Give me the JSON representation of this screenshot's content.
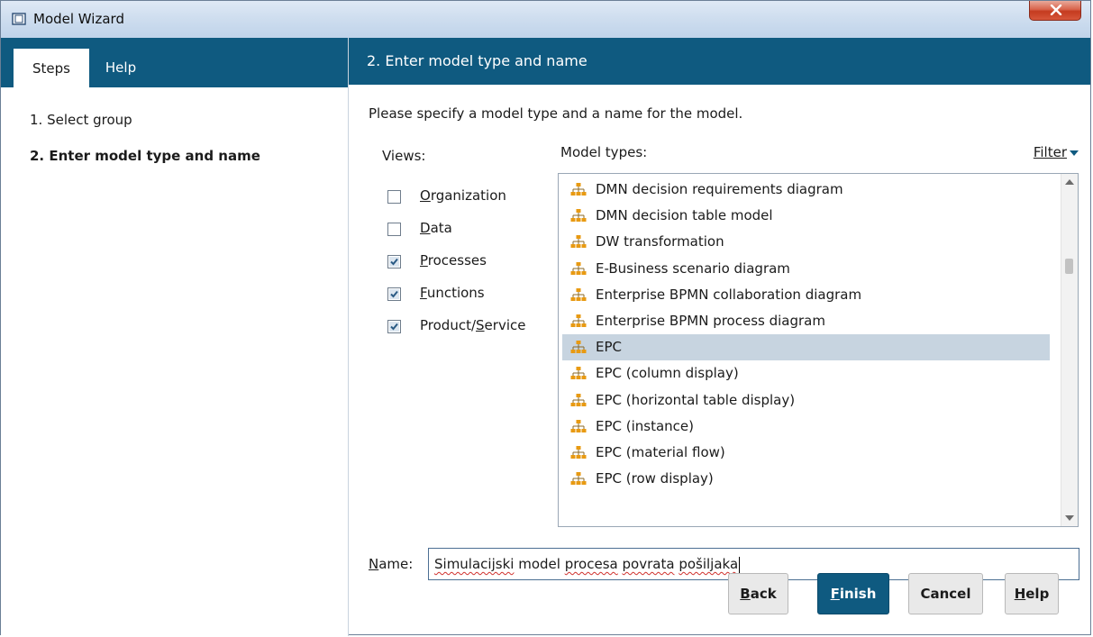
{
  "window": {
    "title": "Model Wizard"
  },
  "left_panel": {
    "tabs": [
      {
        "label": "Steps",
        "active": true
      },
      {
        "label": "Help",
        "active": false
      }
    ],
    "steps": [
      {
        "label": "1. Select group",
        "active": false
      },
      {
        "label": "2. Enter model type and name",
        "active": true
      }
    ]
  },
  "right_panel": {
    "header": "2. Enter model type and name",
    "instruction": "Please specify a model type and a name for the model.",
    "views_label": "Views:",
    "views": [
      {
        "label": "Organization",
        "checked": false
      },
      {
        "label": "Data",
        "checked": false
      },
      {
        "label": "Processes",
        "checked": true
      },
      {
        "label": "Functions",
        "checked": true
      },
      {
        "label": "Product/Service",
        "checked": true
      }
    ],
    "model_types_label": "Model types:",
    "filter_label": "Filter",
    "model_types": [
      {
        "label": "DMN decision requirements diagram",
        "selected": false
      },
      {
        "label": "DMN decision table model",
        "selected": false
      },
      {
        "label": "DW transformation",
        "selected": false
      },
      {
        "label": "E-Business scenario diagram",
        "selected": false
      },
      {
        "label": "Enterprise BPMN collaboration diagram",
        "selected": false
      },
      {
        "label": "Enterprise BPMN process diagram",
        "selected": false
      },
      {
        "label": "EPC",
        "selected": true
      },
      {
        "label": "EPC (column display)",
        "selected": false
      },
      {
        "label": "EPC (horizontal table display)",
        "selected": false
      },
      {
        "label": "EPC (instance)",
        "selected": false
      },
      {
        "label": "EPC (material flow)",
        "selected": false
      },
      {
        "label": "EPC (row display)",
        "selected": false
      }
    ],
    "name_label": "Name:",
    "name_value": "Simulacijski model procesa povrata pošiljaka"
  },
  "buttons": {
    "back": "Back",
    "finish": "Finish",
    "cancel": "Cancel",
    "help": "Help"
  },
  "colors": {
    "accent": "#0f5a80",
    "selection": "#c7d4e0",
    "icon": "#e89a12"
  },
  "icons": {
    "model_type": "hierarchy-icon",
    "window": "window-icon",
    "close": "close-icon",
    "filter": "triangle-down-icon"
  }
}
